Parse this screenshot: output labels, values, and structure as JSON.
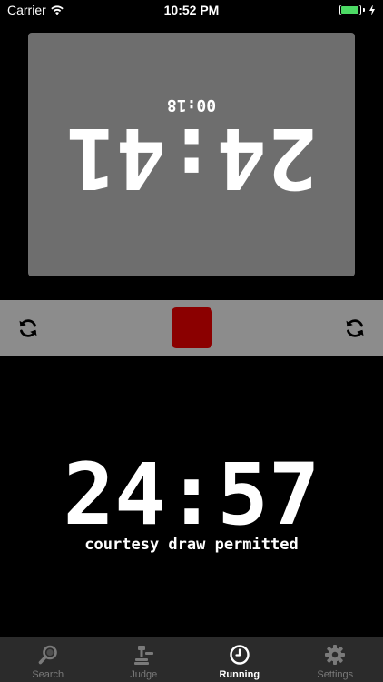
{
  "status_bar": {
    "carrier": "Carrier",
    "time": "10:52 PM",
    "battery_color": "#4cd964"
  },
  "opponent_clock": {
    "time": "24:41",
    "subtime": "00:18",
    "panel_color": "#6e6e6e",
    "orientation": "rotated-180"
  },
  "controls": {
    "reset_left_icon": "reset-icon",
    "reset_right_icon": "reset-icon",
    "stop_icon": "stop-icon",
    "stop_color": "#8b0000",
    "bar_color": "#8c8c8c"
  },
  "player_clock": {
    "time": "24:57",
    "message": "courtesy draw permitted"
  },
  "tab_bar": {
    "items": [
      {
        "label": "Search",
        "icon": "magnifier-icon",
        "active": false
      },
      {
        "label": "Judge",
        "icon": "gavel-icon",
        "active": false
      },
      {
        "label": "Running",
        "icon": "clock-icon",
        "active": true
      },
      {
        "label": "Settings",
        "icon": "gear-icon",
        "active": false
      }
    ]
  }
}
